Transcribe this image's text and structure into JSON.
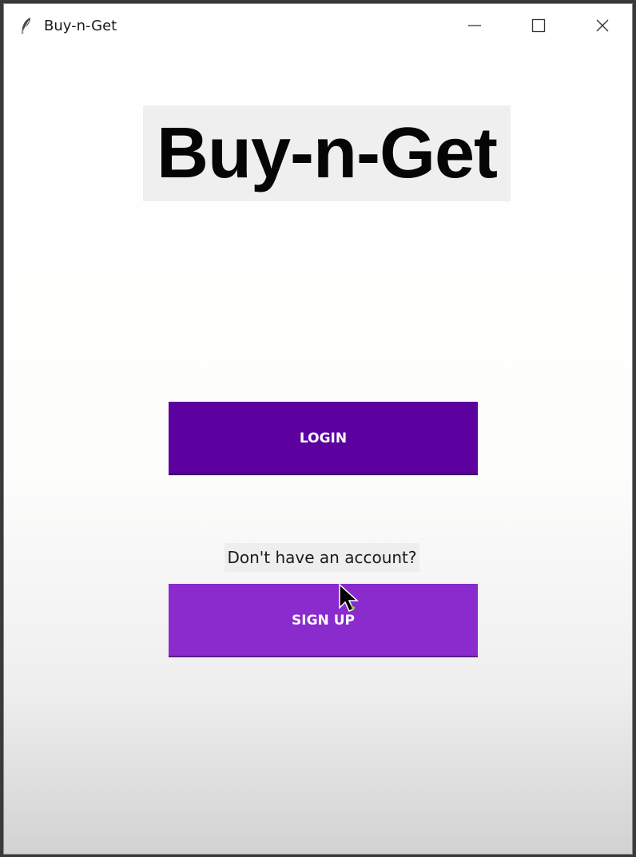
{
  "window": {
    "title": "Buy-n-Get"
  },
  "app": {
    "logo_text": "Buy-n-Get",
    "login_label": "LOGIN",
    "no_account_text": "Don't have an account?",
    "signup_label": "SIGN UP"
  },
  "colors": {
    "login_button": "#5c00a0",
    "signup_button": "#8a2bcd",
    "logo_background": "#efefef"
  },
  "icons": {
    "app": "feather-icon",
    "minimize": "minimize-icon",
    "maximize": "maximize-icon",
    "close": "close-icon",
    "cursor": "mouse-pointer-icon"
  }
}
